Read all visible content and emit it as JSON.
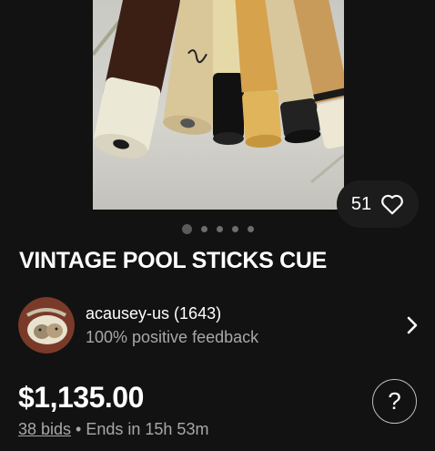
{
  "listing": {
    "like_count": "51",
    "carousel_count": 5,
    "carousel_active": 1,
    "title": "VINTAGE POOL STICKS CUE",
    "seller": {
      "name": "acausey-us (1643)",
      "feedback": "100% positive feedback"
    },
    "price": "$1,135.00",
    "bids": "38 bids",
    "separator": " • ",
    "ends": "Ends in 15h 53m"
  },
  "help": {
    "label": "?"
  },
  "icons": {
    "like": "heart-icon",
    "seller_link": "chevron-right-icon"
  },
  "colors": {
    "background": "#121212",
    "pill": "#1c1c1c",
    "muted_text": "#a8a8a8"
  }
}
